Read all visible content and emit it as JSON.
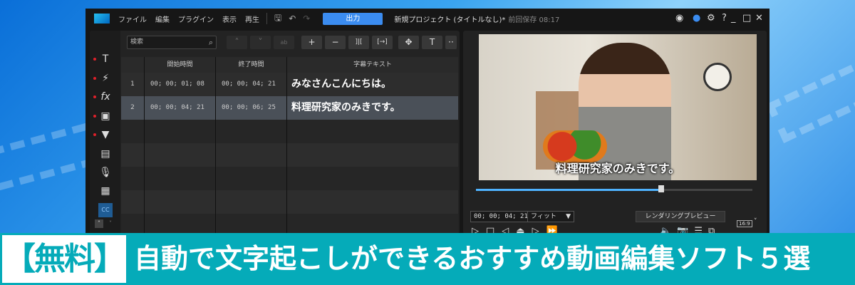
{
  "titlebar": {
    "menus": [
      "ファイル",
      "編集",
      "プラグイン",
      "表示",
      "再生"
    ],
    "output_label": "出力",
    "project": "新規プロジェクト (タイトルなし)*",
    "saved": "前回保存 08:17",
    "help": "?"
  },
  "toolbar": {
    "search_placeholder": "検索"
  },
  "table": {
    "headers": [
      "開始時間",
      "終了時間",
      "字幕テキスト"
    ],
    "rows": [
      {
        "n": "1",
        "start": "00; 00; 01; 08",
        "end": "00; 00; 04; 21",
        "text": "みなさんこんにちは。"
      },
      {
        "n": "2",
        "start": "00; 00; 04; 21",
        "end": "00; 00; 06; 25",
        "text": "料理研究家のみきです。"
      }
    ]
  },
  "preview": {
    "subtitle": "料理研究家のみきです。",
    "progress": 0.67,
    "timecode": "00; 00; 04; 21",
    "zoom": "フィット",
    "render_label": "レンダリングプレビュー",
    "aspect": "16:9"
  },
  "banner": {
    "badge": "【無料】",
    "headline": "自動で文字起こしができるおすすめ動画編集ソフト５選"
  },
  "colors": {
    "accent": "#3b8cf0",
    "banner": "#05abb9"
  }
}
